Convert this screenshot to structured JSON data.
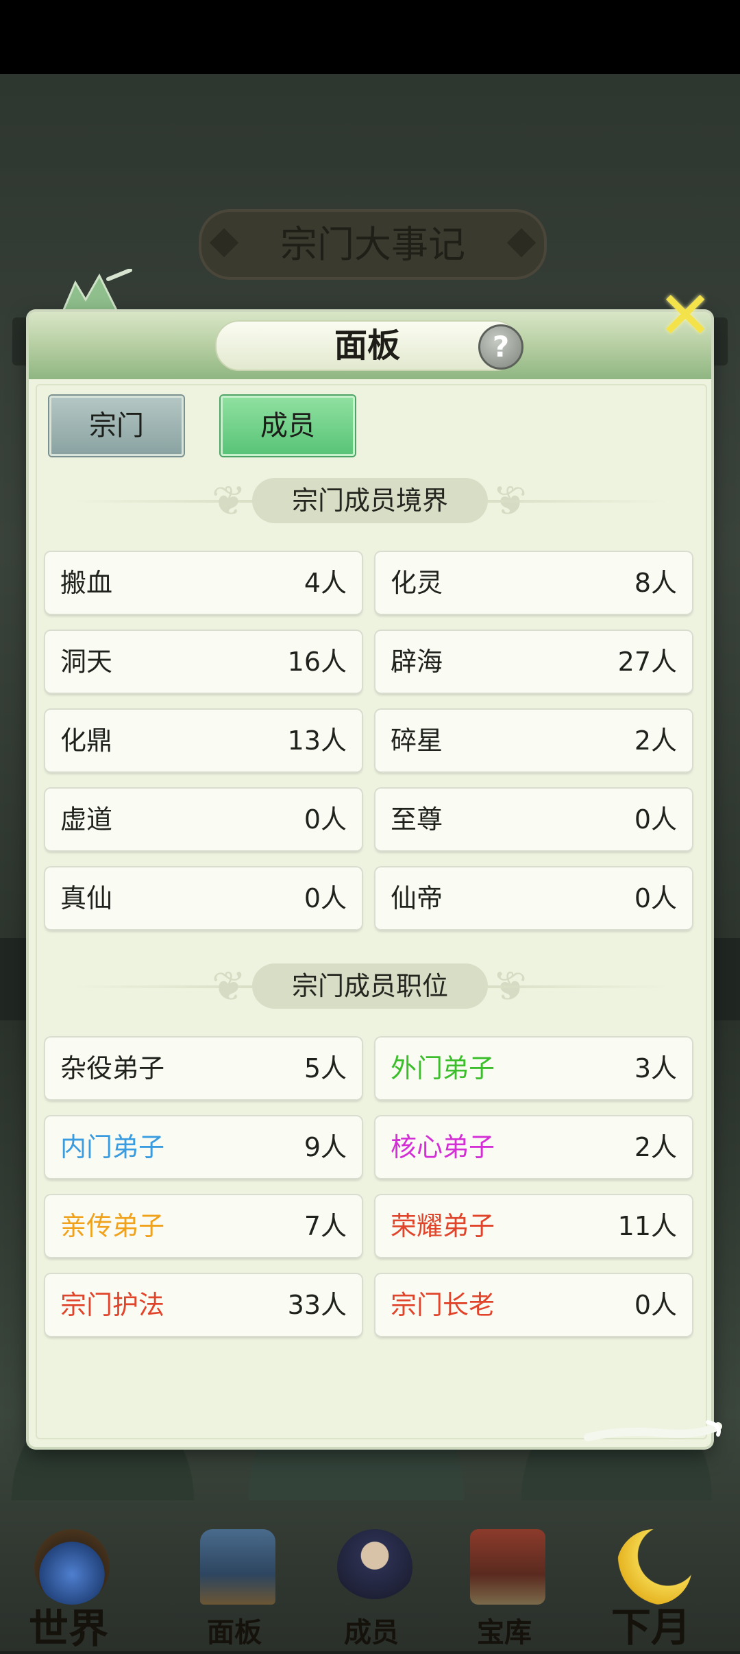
{
  "background": {
    "event_log_title": "宗门大事记"
  },
  "panel": {
    "title": "面板",
    "help_icon": "?",
    "close_icon": "✕"
  },
  "tabs": [
    {
      "label": "宗门",
      "active": false
    },
    {
      "label": "成员",
      "active": true
    }
  ],
  "realm_section": {
    "title": "宗门成员境界",
    "items": [
      {
        "label": "搬血",
        "value": "4人"
      },
      {
        "label": "化灵",
        "value": "8人"
      },
      {
        "label": "洞天",
        "value": "16人"
      },
      {
        "label": "辟海",
        "value": "27人"
      },
      {
        "label": "化鼎",
        "value": "13人"
      },
      {
        "label": "碎星",
        "value": "2人"
      },
      {
        "label": "虚道",
        "value": "0人"
      },
      {
        "label": "至尊",
        "value": "0人"
      },
      {
        "label": "真仙",
        "value": "0人"
      },
      {
        "label": "仙帝",
        "value": "0人"
      }
    ]
  },
  "position_section": {
    "title": "宗门成员职位",
    "items": [
      {
        "label": "杂役弟子",
        "value": "5人",
        "color": "#1f211c"
      },
      {
        "label": "外门弟子",
        "value": "3人",
        "color": "#3cbd2b"
      },
      {
        "label": "内门弟子",
        "value": "9人",
        "color": "#3a9ce0"
      },
      {
        "label": "核心弟子",
        "value": "2人",
        "color": "#d42fd6"
      },
      {
        "label": "亲传弟子",
        "value": "7人",
        "color": "#f0a21c"
      },
      {
        "label": "荣耀弟子",
        "value": "11人",
        "color": "#e0452c"
      },
      {
        "label": "宗门护法",
        "value": "33人",
        "color": "#e0452c"
      },
      {
        "label": "宗门长老",
        "value": "0人",
        "color": "#e0452c"
      }
    ]
  },
  "bottom_nav": [
    {
      "label": "世界",
      "icon": "palace-orb-icon"
    },
    {
      "label": "面板",
      "icon": "gate-icon"
    },
    {
      "label": "成员",
      "icon": "cultivator-icon"
    },
    {
      "label": "宝库",
      "icon": "pagoda-icon"
    },
    {
      "label": "下月",
      "icon": "crescent-moon-icon"
    }
  ]
}
